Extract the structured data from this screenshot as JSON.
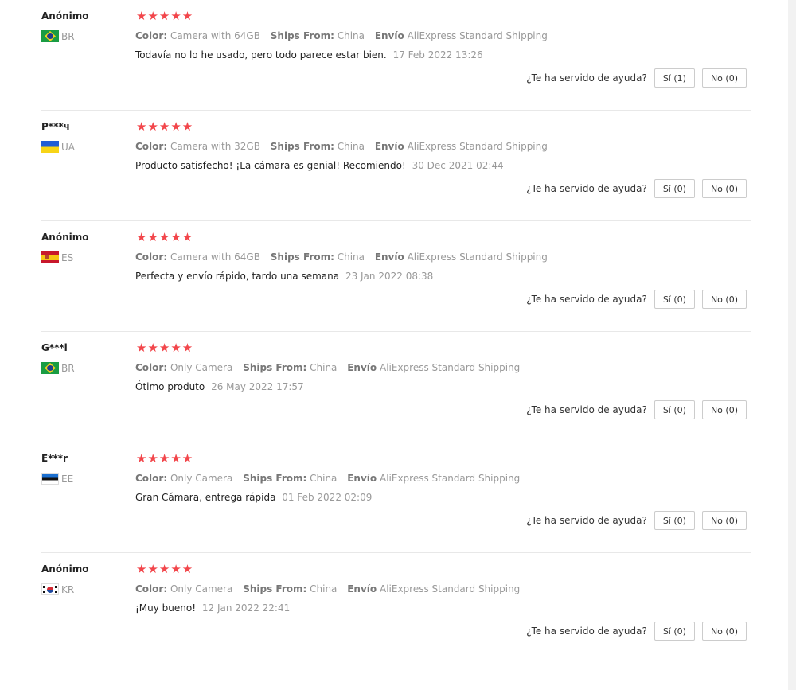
{
  "labels": {
    "color": "Color:",
    "ships_from": "Ships From:",
    "envio": "Envío",
    "helpful_question": "¿Te ha servido de ayuda?",
    "star_glyph": "★★★★★"
  },
  "colors": {
    "star": "#f2464b",
    "meta": "#999999",
    "panel": "#ffffff",
    "page_bg": "#f2f2f2"
  },
  "reviews": [
    {
      "user": "Anónimo",
      "country": "BR",
      "flag": "flag-br",
      "rating": 5,
      "color": "Camera with 64GB",
      "ships_from": "China",
      "shipping": "AliExpress Standard Shipping",
      "text": "Todavía no lo he usado, pero todo parece estar bien.",
      "date": "17 Feb 2022 13:26",
      "yes": "Sí (1)",
      "no": "No (0)"
    },
    {
      "user": "P***ч",
      "country": "UA",
      "flag": "flag-ua",
      "rating": 5,
      "color": "Camera with 32GB",
      "ships_from": "China",
      "shipping": "AliExpress Standard Shipping",
      "text": "Producto satisfecho! ¡La cámara es genial! Recomiendo!",
      "date": "30 Dec 2021 02:44",
      "yes": "Sí (0)",
      "no": "No (0)"
    },
    {
      "user": "Anónimo",
      "country": "ES",
      "flag": "flag-es",
      "rating": 5,
      "color": "Camera with 64GB",
      "ships_from": "China",
      "shipping": "AliExpress Standard Shipping",
      "text": "Perfecta y envío rápido, tardo una semana",
      "date": "23 Jan 2022 08:38",
      "yes": "Sí (0)",
      "no": "No (0)"
    },
    {
      "user": "G***l",
      "country": "BR",
      "flag": "flag-br",
      "rating": 5,
      "color": "Only Camera",
      "ships_from": "China",
      "shipping": "AliExpress Standard Shipping",
      "text": "Ótimo produto",
      "date": "26 May 2022 17:57",
      "yes": "Sí (0)",
      "no": "No (0)"
    },
    {
      "user": "E***r",
      "country": "EE",
      "flag": "flag-ee",
      "rating": 5,
      "color": "Only Camera",
      "ships_from": "China",
      "shipping": "AliExpress Standard Shipping",
      "text": "Gran Cámara, entrega rápida",
      "date": "01 Feb 2022 02:09",
      "yes": "Sí (0)",
      "no": "No (0)"
    },
    {
      "user": "Anónimo",
      "country": "KR",
      "flag": "flag-kr",
      "rating": 5,
      "color": "Only Camera",
      "ships_from": "China",
      "shipping": "AliExpress Standard Shipping",
      "text": "¡Muy bueno!",
      "date": "12 Jan 2022 22:41",
      "yes": "Sí (0)",
      "no": "No (0)"
    }
  ]
}
